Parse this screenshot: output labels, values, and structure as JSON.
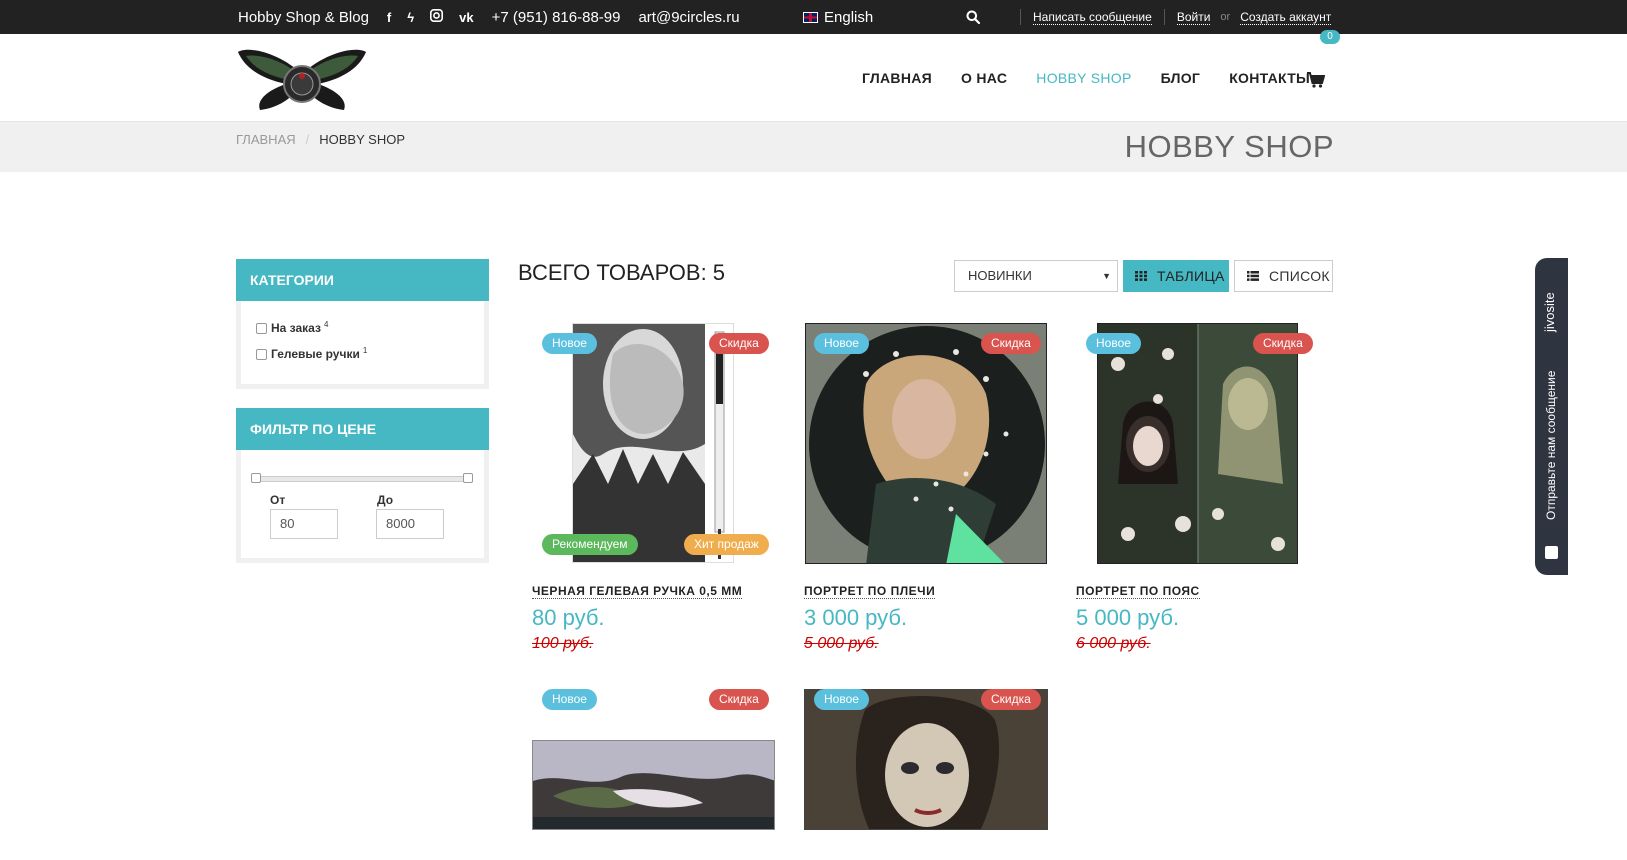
{
  "topbar": {
    "site_name": "Hobby Shop & Blog",
    "social_icons": [
      "facebook-icon",
      "deviantart-icon",
      "instagram-icon",
      "vk-icon"
    ],
    "phone": "+7 (951) 816-88-99",
    "email": "art@9circles.ru",
    "language": "English",
    "write_message": "Написать сообщение",
    "login": "Войти",
    "or": "or",
    "register": "Создать аккаунт"
  },
  "nav": {
    "items": [
      "ГЛАВНАЯ",
      "О НАС",
      "HOBBY SHOP",
      "БЛОГ",
      "КОНТАКТЫ"
    ],
    "active_index": 2,
    "cart_count": "0"
  },
  "breadcrumb": {
    "home": "ГЛАВНАЯ",
    "separator": "/",
    "current": "HOBBY SHOP"
  },
  "page_title": "HOBBY SHOP",
  "sidebar": {
    "categories_title": "КАТЕГОРИИ",
    "categories": [
      {
        "label": "На заказ",
        "count": "4"
      },
      {
        "label": "Гелевые ручки",
        "count": "1"
      }
    ],
    "price_filter_title": "ФИЛЬТР ПО ЦЕНЕ",
    "from_label": "От",
    "to_label": "До",
    "from_value": "80",
    "to_value": "8000"
  },
  "main": {
    "count_title": "ВСЕГО ТОВАРОВ: 5",
    "sort_value": "НОВИНКИ",
    "view_table": "ТАБЛИЦА",
    "view_list": "СПИСОК"
  },
  "badges": {
    "new": "Новое",
    "sale": "Скидка",
    "recommended": "Рекомендуем",
    "hit": "Хит продаж"
  },
  "products": [
    {
      "name": "ЧЕРНАЯ ГЕЛЕВАЯ РУЧКА 0,5 ММ",
      "price": "80 руб.",
      "old_price": "100 руб."
    },
    {
      "name": "ПОРТРЕТ ПО ПЛЕЧИ",
      "price": "3 000 руб.",
      "old_price": "5 000 руб."
    },
    {
      "name": "ПОРТРЕТ ПО ПОЯС",
      "price": "5 000 руб.",
      "old_price": "6 000 руб."
    }
  ],
  "jivo": {
    "brand": "jivosite",
    "text": "Отправьте нам сообщение"
  },
  "colors": {
    "accent": "#46b8c4",
    "topbar": "#222222",
    "badge_new": "#5bc0de",
    "badge_sale": "#d9534f",
    "badge_recommended": "#5cb85c",
    "badge_hit": "#f0ad4e",
    "old_price": "#cc0000"
  }
}
